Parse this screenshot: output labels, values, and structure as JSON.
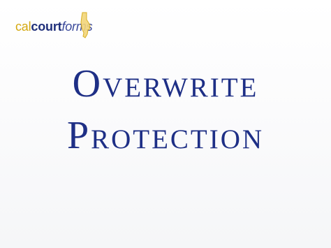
{
  "logo": {
    "text_cal": "cal",
    "text_court": "court",
    "text_forms": "forms",
    "icon": "california-state-outline-icon",
    "colors": {
      "cal": "#d4a80f",
      "court": "#1f2f7a",
      "forms": "#3b4a9b"
    }
  },
  "slide": {
    "title_line_1": "Overwrite",
    "title_line_2": "Protection",
    "title_color": "#1e2f86"
  }
}
